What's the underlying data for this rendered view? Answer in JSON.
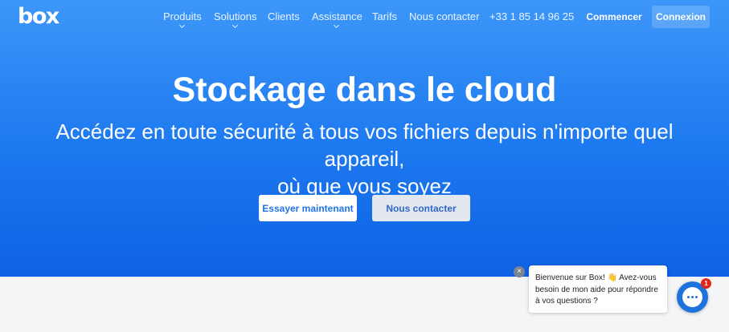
{
  "brand": {
    "logo_text": "box"
  },
  "nav": {
    "items": [
      {
        "label": "Produits",
        "has_dropdown": true
      },
      {
        "label": "Solutions",
        "has_dropdown": true
      },
      {
        "label": "Clients",
        "has_dropdown": false
      },
      {
        "label": "Assistance",
        "has_dropdown": true
      },
      {
        "label": "Tarifs",
        "has_dropdown": false
      },
      {
        "label": "Nous contacter",
        "has_dropdown": false
      },
      {
        "label": "+33 1 85 14 96 25",
        "has_dropdown": false
      }
    ],
    "start_label": "Commencer",
    "login_label": "Connexion"
  },
  "hero": {
    "title": "Stockage dans le cloud",
    "subtitle_line1": "Accédez en toute sécurité à tous vos fichiers depuis n'importe quel appareil,",
    "subtitle_line2": "où que vous soyez",
    "cta_primary": "Essayer maintenant",
    "cta_secondary": "Nous contacter"
  },
  "chat": {
    "close_symbol": "×",
    "message": "Bienvenue sur Box! 👋 Avez-vous besoin de mon aide pour répondre à vos questions ?",
    "badge_count": "1"
  },
  "colors": {
    "hero_top": "#3d97f9",
    "hero_bottom": "#0f62e3",
    "accent": "#2173e8",
    "badge": "#e0251b"
  }
}
